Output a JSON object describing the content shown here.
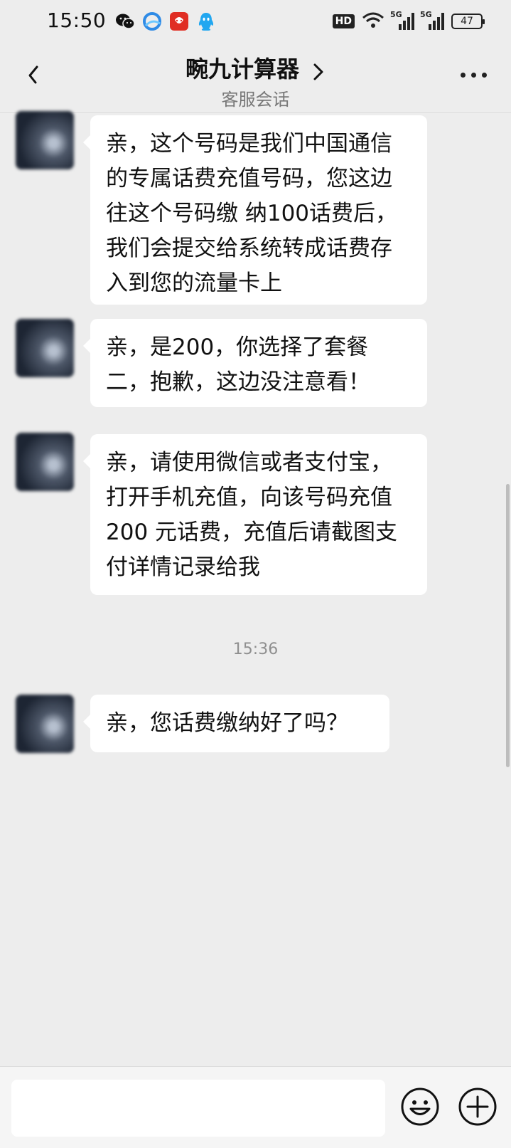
{
  "status_bar": {
    "time": "15:50",
    "app_icons": [
      "wechat-icon",
      "browser-icon",
      "pinduoduo-icon",
      "qq-icon"
    ],
    "hd_label": "HD",
    "network_1": "5G",
    "network_2": "5G",
    "battery": "47"
  },
  "header": {
    "title": "畹九计算器",
    "subtitle": "客服会话"
  },
  "messages": [
    {
      "text": "亲，这个号码是我们中国通信的专属话费充值号码，您这边往这个号码缴 纳100话费后，我们会提交给系统转成话费存入到您的流量卡上"
    },
    {
      "text": "亲，是200，你选择了套餐二，抱歉，这边没注意看！"
    },
    {
      "text": "亲，请使用微信或者支付宝，打开手机充值，向该号码充值200 元话费，充值后请截图支付详情记录给我"
    },
    {
      "text": "亲，您话费缴纳好了吗？"
    }
  ],
  "timestamp": "15:36",
  "composer": {
    "placeholder": ""
  },
  "colors": {
    "background": "#ededed",
    "bubble": "#ffffff",
    "accent": "#111111"
  }
}
